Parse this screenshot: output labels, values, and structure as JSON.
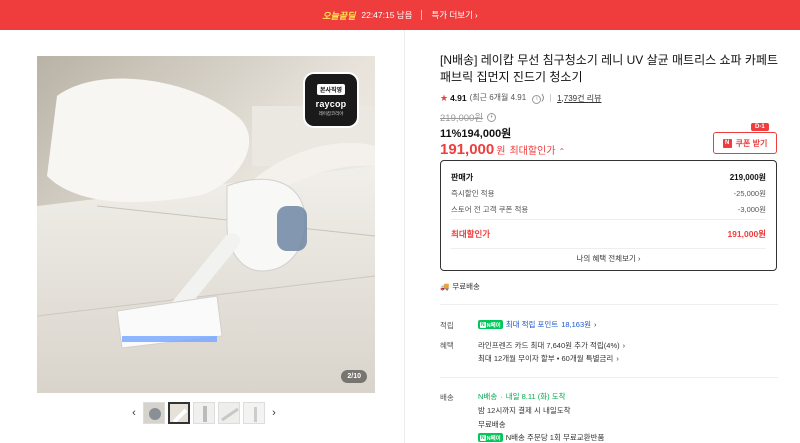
{
  "banner": {
    "brand": "오늘끝딜",
    "timer": "22:47:15 남음",
    "more": "특가 더보기"
  },
  "gallery": {
    "counter": "2/10",
    "badge_top": "본사직영",
    "badge_brand": "raycop",
    "badge_sub": "레이캅코리아"
  },
  "product": {
    "title": "[N배송] 레이캅 무선 침구청소기 레니 UV 살균 매트리스 쇼파 카페트 패브릭 집먼지 진드기 청소기",
    "rating": "4.91",
    "rating_recent": "(최근 6개월 4.91",
    "reviews": "1,739건 리뷰",
    "original_price": "219,000원",
    "discount_rate": "11%",
    "discount_price": "194,000원",
    "max_price": "191,000",
    "max_price_unit": "원",
    "max_label": "최대할인가",
    "coupon_label": "쿠폰 받기",
    "coupon_dday": "D-1"
  },
  "pricebox": {
    "sale_label": "판매가",
    "sale_value": "219,000원",
    "instant_label": "즉시할인 적용",
    "instant_value": "-25,000원",
    "store_label": "스토어 전 고객 쿠폰 적용",
    "store_value": "-3,000원",
    "max_label": "최대할인가",
    "max_value": "191,000원",
    "more": "나의 혜택 전체보기"
  },
  "shipping": {
    "free": "무료배송"
  },
  "points": {
    "label": "적립",
    "npay_label": "N페이",
    "text": "최대 적립 포인트",
    "value": "18,163원"
  },
  "benefit": {
    "label": "혜택",
    "line1": "라인프렌즈 카드 최대 7,640원 추가 적립(4%)",
    "line2": "최대 12개월 무이자 할부 • 60개월 특별금리"
  },
  "delivery": {
    "label": "배송",
    "nship": "N배송",
    "arrival": "내일 8.11 (화) 도착",
    "cutoff": "밤 12시까지 결제 시 내일도착",
    "free": "무료배송",
    "return_prefix": "N페이",
    "return_text": "N배송 주문당 1회 무료교환반품"
  },
  "colors": {
    "accent": "#ef3d3d",
    "npay": "#03c75a",
    "link_blue": "#1a55c9"
  }
}
